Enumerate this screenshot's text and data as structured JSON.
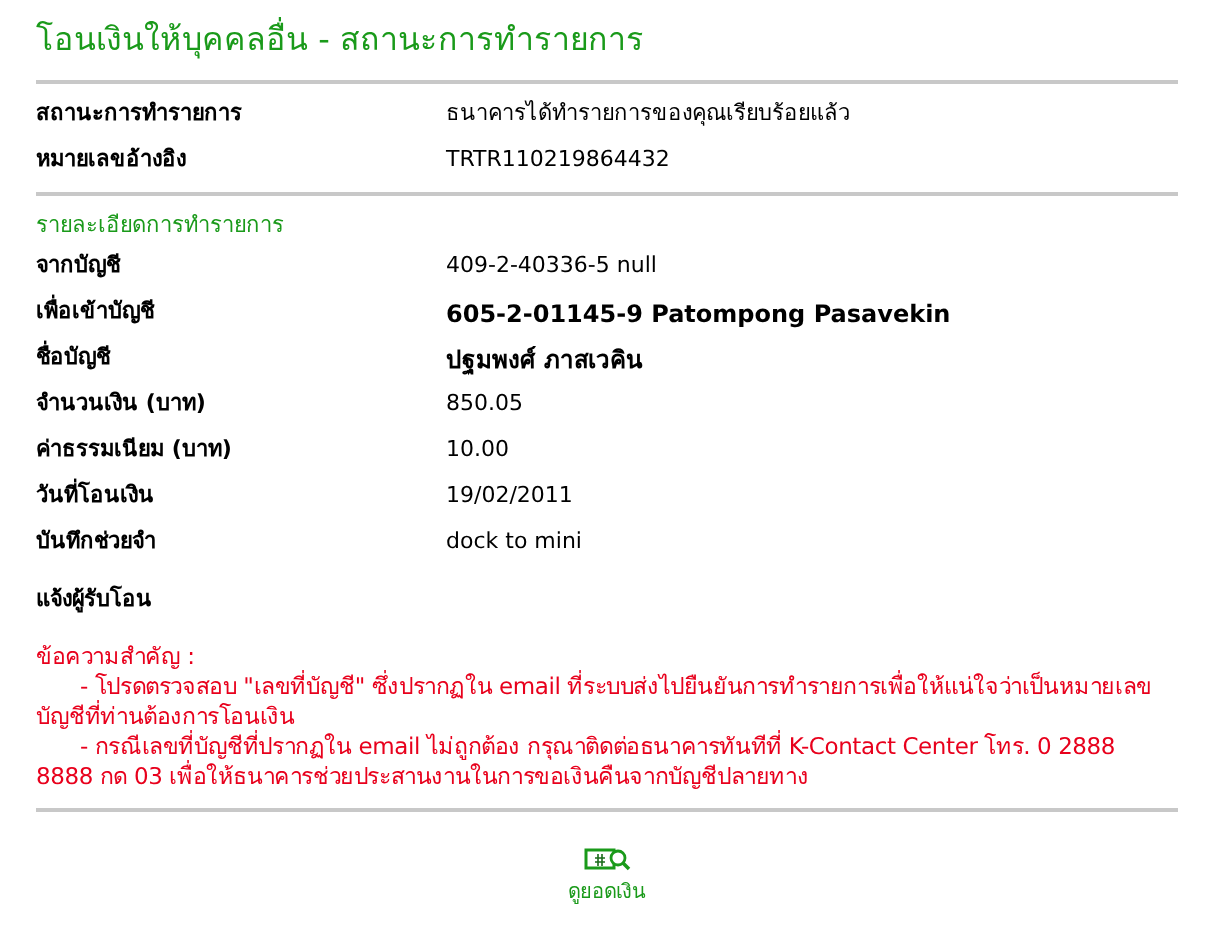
{
  "title": "โอนเงินให้บุคคลอื่น - สถานะการทำรายการ",
  "status_rows": [
    {
      "label": "สถานะการทำรายการ",
      "value": "ธนาคารได้ทำรายการของคุณเรียบร้อยแล้ว",
      "bold": false
    },
    {
      "label": "หมายเลขอ้างอิง",
      "value": "TRTR110219864432",
      "bold": false
    }
  ],
  "details": {
    "heading": "รายละเอียดการทำรายการ",
    "rows": [
      {
        "label": "จากบัญชี",
        "value": "409-2-40336-5 null",
        "bold": false
      },
      {
        "label": "เพื่อเข้าบัญชี",
        "value": "605-2-01145-9 Patompong Pasavekin",
        "bold": true
      },
      {
        "label": "ชื่อบัญชี",
        "value": "ปฐมพงศ์ ภาสเวคิน",
        "bold": true
      },
      {
        "label": "จำนวนเงิน (บาท)",
        "value": "850.05",
        "bold": false
      },
      {
        "label": "ค่าธรรมเนียม (บาท)",
        "value": "10.00",
        "bold": false
      },
      {
        "label": "วันที่โอนเงิน",
        "value": "19/02/2011",
        "bold": false
      },
      {
        "label": "บันทึกช่วยจำ",
        "value": "dock to mini",
        "bold": false
      }
    ],
    "notify_label": "แจ้งผู้รับโอน"
  },
  "notice": {
    "heading": "ข้อความสำคัญ :",
    "items": [
      "- โปรดตรวจสอบ \"เลขที่บัญชี\" ซึ่งปรากฏใน email ที่ระบบส่งไปยืนยันการทำรายการเพื่อให้แน่ใจว่าเป็นหมายเลขบัญชีที่ท่านต้องการโอนเงิน",
      "- กรณีเลขที่บัญชีที่ปรากฏใน email ไม่ถูกต้อง กรุณาติดต่อธนาคารทันทีที่ K-Contact Center โทร. 0 2888 8888 กด 03 เพื่อให้ธนาคารช่วยประสานงานในการขอเงินคืนจากบัญชีปลายทาง"
    ]
  },
  "action": {
    "label": "ดูยอดเงิน"
  }
}
